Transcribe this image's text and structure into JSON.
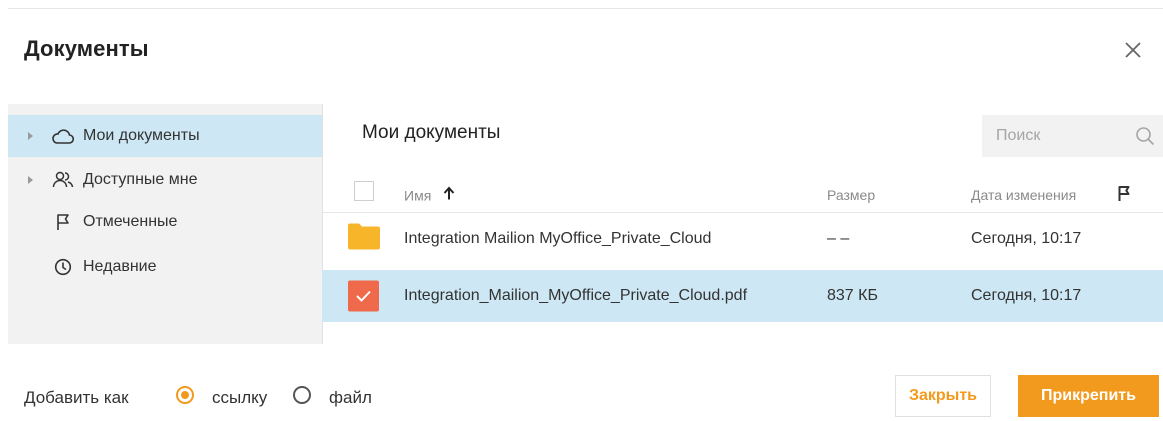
{
  "dialog": {
    "title": "Документы",
    "close_icon": "close-icon"
  },
  "sidebar": {
    "items": [
      {
        "label": "Мои документы",
        "icon": "cloud-icon",
        "expandable": true,
        "active": true
      },
      {
        "label": "Доступные мне",
        "icon": "people-icon",
        "expandable": true,
        "active": false
      },
      {
        "label": "Отмеченные",
        "icon": "flag-icon",
        "expandable": false,
        "active": false
      },
      {
        "label": "Недавние",
        "icon": "clock-icon",
        "expandable": false,
        "active": false
      }
    ]
  },
  "main": {
    "title": "Мои документы",
    "search_placeholder": "Поиск",
    "columns": {
      "name": "Имя",
      "size": "Размер",
      "modified": "Дата изменения",
      "flag_icon": "flag-icon"
    },
    "sort": {
      "column": "name",
      "icon": "arrow-up-icon"
    },
    "rows": [
      {
        "type": "folder",
        "name": "Integration Mailion MyOffice_Private_Cloud",
        "size": "– –",
        "modified": "Сегодня, 10:17",
        "selected": false
      },
      {
        "type": "file",
        "name": "Integration_Mailion_MyOffice_Private_Cloud.pdf",
        "size": "837 КБ",
        "modified": "Сегодня, 10:17",
        "selected": true
      }
    ]
  },
  "footer": {
    "add_as_label": "Добавить как",
    "options": [
      {
        "label": "ссылку",
        "checked": true
      },
      {
        "label": "файл",
        "checked": false
      }
    ],
    "close_button": "Закрыть",
    "attach_button": "Прикрепить"
  },
  "colors": {
    "accent": "#f29a1d",
    "selection": "#cde7f4",
    "folder": "#f7b52a",
    "checkbox_checked": "#ee6a4a"
  }
}
